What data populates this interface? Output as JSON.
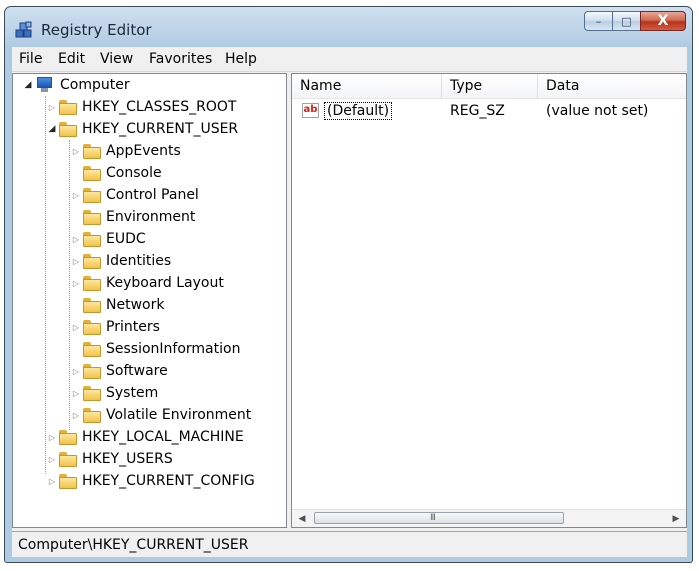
{
  "window": {
    "title": "Registry Editor"
  },
  "caption": {
    "minimize": "–",
    "maximize": "□",
    "close": "X"
  },
  "menu": [
    "File",
    "Edit",
    "View",
    "Favorites",
    "Help"
  ],
  "tree": {
    "root": "Computer",
    "hives": {
      "classes_root": "HKEY_CLASSES_ROOT",
      "current_user": "HKEY_CURRENT_USER",
      "local_machine": "HKEY_LOCAL_MACHINE",
      "users": "HKEY_USERS",
      "current_config": "HKEY_CURRENT_CONFIG"
    },
    "current_user_children": [
      "AppEvents",
      "Console",
      "Control Panel",
      "Environment",
      "EUDC",
      "Identities",
      "Keyboard Layout",
      "Network",
      "Printers",
      "SessionInformation",
      "Software",
      "System",
      "Volatile Environment"
    ]
  },
  "list": {
    "columns": {
      "name": "Name",
      "type": "Type",
      "data": "Data"
    },
    "rows": [
      {
        "icon": "ab",
        "name": "(Default)",
        "type": "REG_SZ",
        "data": "(value not set)"
      }
    ],
    "scroll_grip": "III"
  },
  "status": {
    "path": "Computer\\HKEY_CURRENT_USER"
  }
}
